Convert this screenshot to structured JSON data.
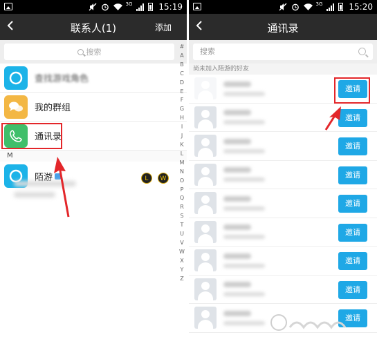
{
  "left": {
    "status": {
      "network": "3G",
      "time": "15:19"
    },
    "header": {
      "title": "联系人(1)",
      "action": "添加"
    },
    "search": {
      "placeholder": "搜索"
    },
    "items": [
      {
        "label": "查找游戏角色"
      },
      {
        "label": "我的群组"
      },
      {
        "label": "通讯录"
      }
    ],
    "section_letter": "M",
    "contact": {
      "name": "陌游",
      "badge_l": "L",
      "badge_w": "W"
    },
    "index_letters": [
      "#",
      "A",
      "B",
      "C",
      "D",
      "E",
      "F",
      "G",
      "H",
      "I",
      "J",
      "K",
      "L",
      "M",
      "N",
      "O",
      "P",
      "Q",
      "R",
      "S",
      "T",
      "U",
      "V",
      "W",
      "X",
      "Y",
      "Z"
    ]
  },
  "right": {
    "status": {
      "network": "3G",
      "time": "15:20"
    },
    "header": {
      "title": "通讯录"
    },
    "search": {
      "placeholder": "搜索"
    },
    "hint": "尚未加入陌游的好友",
    "invite_label": "邀请",
    "rows": 9
  },
  "colors": {
    "accent_blue": "#1fa8e6",
    "highlight_red": "#e3262a",
    "nav_bg": "#2b2b2b"
  }
}
